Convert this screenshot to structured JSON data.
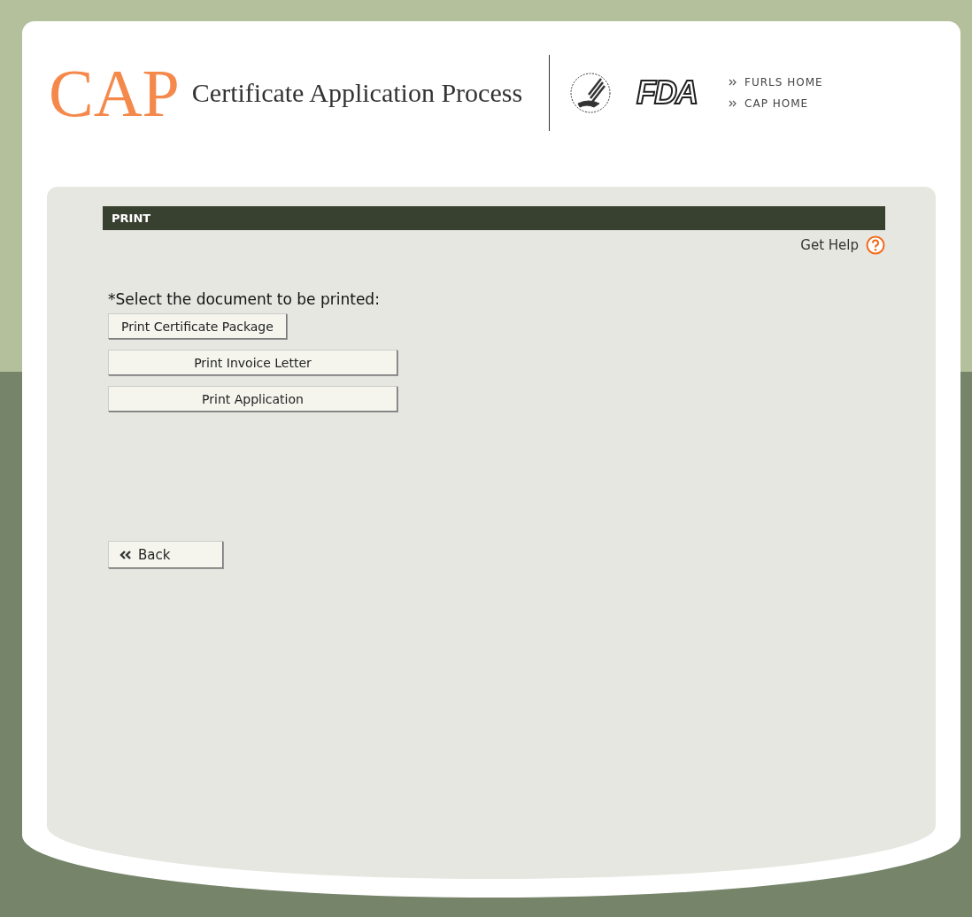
{
  "header": {
    "logo": "CAP",
    "title": "Certificate Application Process",
    "agency_logo": "FDA",
    "links": [
      {
        "label": "FURLS HOME"
      },
      {
        "label": "CAP HOME"
      }
    ]
  },
  "section": {
    "title": "PRINT",
    "help": "Get Help"
  },
  "prompt": "*Select the document to be printed:",
  "buttons": [
    {
      "label": "Print Certificate Package",
      "kind": "compact"
    },
    {
      "label": "Print Invoice Letter",
      "kind": "wide"
    },
    {
      "label": "Print Application",
      "kind": "wide"
    }
  ],
  "back_button": {
    "label": "Back"
  }
}
